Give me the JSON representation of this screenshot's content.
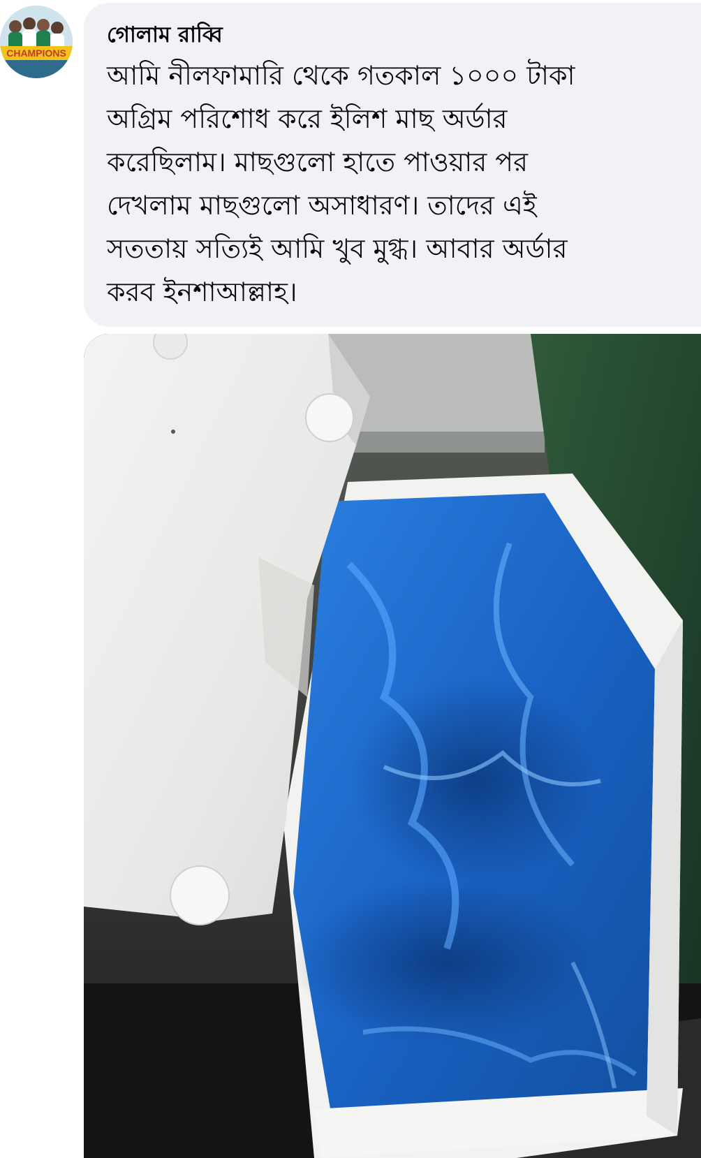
{
  "comment": {
    "author": "গোলাম রাব্বি",
    "avatar_badge": "CHAMPIONS",
    "text_lines": [
      "আমি নীলফামারি থেকে গতকাল ১০০০ টাকা",
      "অগ্রিম পরিশোধ করে ইলিশ মাছ অর্ডার",
      "করেছিলাম। মাছগুলো হাতে পাওয়ার পর",
      "দেখলাম মাছগুলো অসাধারণ।  তাদের এই",
      "সততায় সত্যিই আমি খুব মুগ্ধ। আবার অর্ডার",
      "করব ইনশাআল্লাহ।"
    ]
  },
  "colors": {
    "bubble_bg": "#f0f2f5",
    "text": "#050505",
    "plastic_blue": "#1f6fd1",
    "styrofoam": "#f4f4f2"
  },
  "attachment": {
    "type": "photo",
    "icon": "photo-attachment"
  }
}
